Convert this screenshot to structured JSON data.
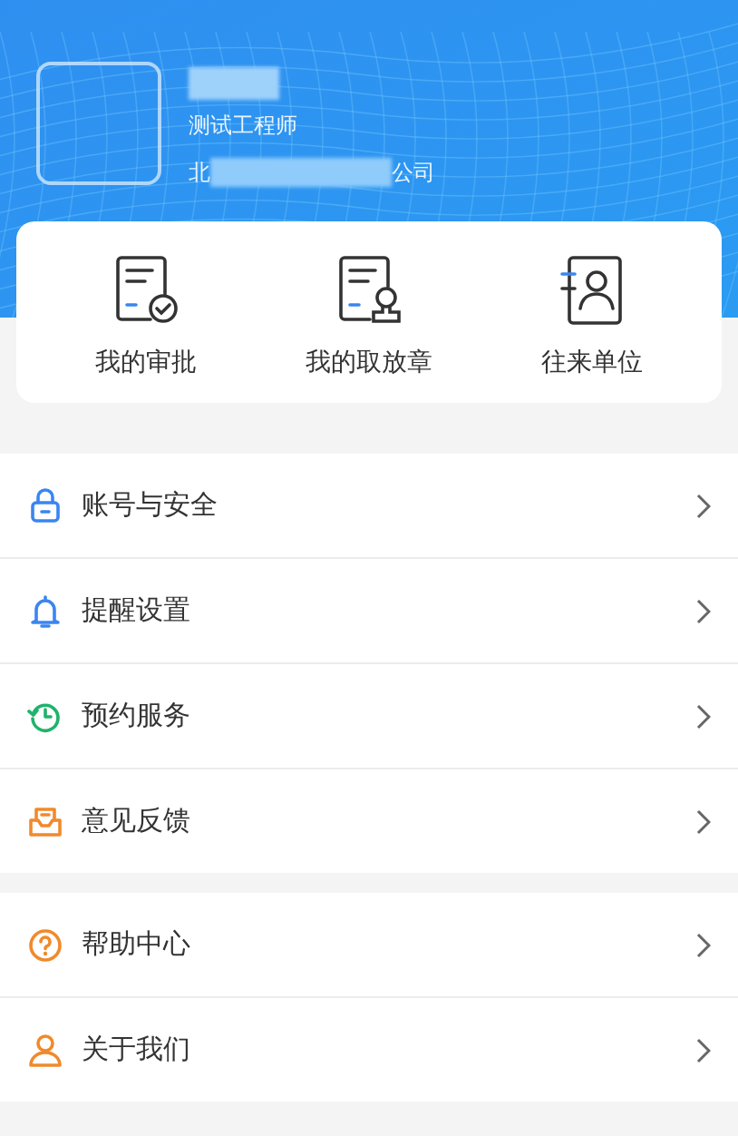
{
  "profile": {
    "role": "测试工程师",
    "company_parts": [
      "北",
      "公司"
    ]
  },
  "shortcuts": [
    {
      "kind": "approval",
      "label": "我的审批"
    },
    {
      "kind": "seal",
      "label": "我的取放章"
    },
    {
      "kind": "contacts",
      "label": "往来单位"
    }
  ],
  "menu_groups": [
    [
      {
        "kind": "lock",
        "label": "账号与安全",
        "color": "#3a86f0"
      },
      {
        "kind": "bell",
        "label": "提醒设置",
        "color": "#3a86f0"
      },
      {
        "kind": "history",
        "label": "预约服务",
        "color": "#1fb36b"
      },
      {
        "kind": "inbox",
        "label": "意见反馈",
        "color": "#f08a2c"
      }
    ],
    [
      {
        "kind": "help",
        "label": "帮助中心",
        "color": "#f08a2c"
      },
      {
        "kind": "user",
        "label": "关于我们",
        "color": "#f08a2c"
      }
    ]
  ]
}
